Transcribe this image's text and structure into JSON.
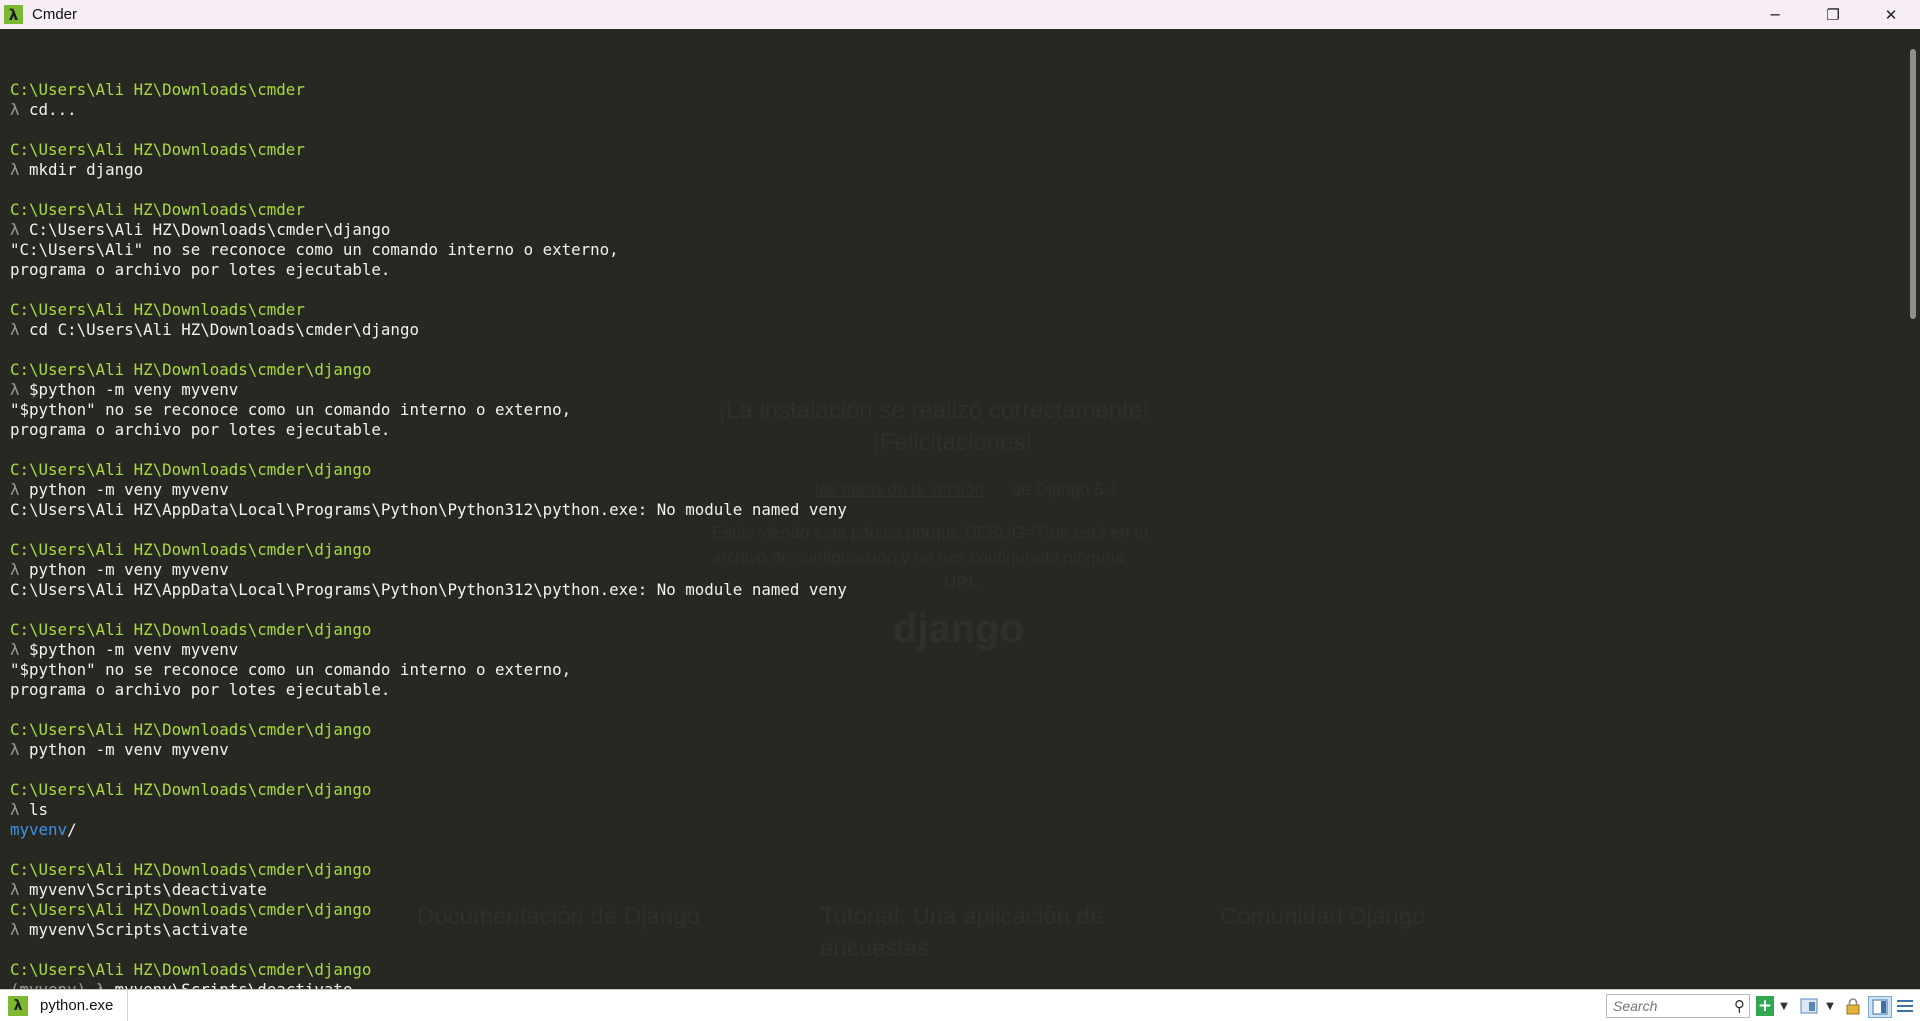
{
  "window": {
    "title": "Cmder",
    "app_icon_glyph": "λ",
    "minimize_glyph": "─",
    "restore_glyph": "❐",
    "close_glyph": "✕"
  },
  "background_ghost": {
    "heading1": "¡La instalación se realizó correctamente!",
    "heading2": "¡Felicitaciones!",
    "notes_link": "las notas de la versión",
    "notes_rest": "de Django 5.1",
    "debug_line1": "Estás viendo esta página porque DEBUG=True está en tu",
    "debug_line2": "archivo de configuración y no has configurado ninguna",
    "debug_line3": "URL.",
    "brand": "django",
    "footer_docs": "Documentación de Django",
    "footer_tutorial": "Tutorial: Una aplicación de",
    "footer_tutorial2": "encuestas",
    "footer_community": "Comunidad Django"
  },
  "terminal": {
    "lines": [
      {
        "type": "blank"
      },
      {
        "type": "path",
        "text": "C:\\Users\\Ali HZ\\Downloads\\cmder"
      },
      {
        "type": "cmd",
        "text": "cd..."
      },
      {
        "type": "blank"
      },
      {
        "type": "path",
        "text": "C:\\Users\\Ali HZ\\Downloads\\cmder"
      },
      {
        "type": "cmd",
        "text": "mkdir django"
      },
      {
        "type": "blank"
      },
      {
        "type": "path",
        "text": "C:\\Users\\Ali HZ\\Downloads\\cmder"
      },
      {
        "type": "cmd",
        "text": "C:\\Users\\Ali HZ\\Downloads\\cmder\\django"
      },
      {
        "type": "out",
        "text": "\"C:\\Users\\Ali\" no se reconoce como un comando interno o externo,"
      },
      {
        "type": "out",
        "text": "programa o archivo por lotes ejecutable."
      },
      {
        "type": "blank"
      },
      {
        "type": "path",
        "text": "C:\\Users\\Ali HZ\\Downloads\\cmder"
      },
      {
        "type": "cmd",
        "text": "cd C:\\Users\\Ali HZ\\Downloads\\cmder\\django"
      },
      {
        "type": "blank"
      },
      {
        "type": "path",
        "text": "C:\\Users\\Ali HZ\\Downloads\\cmder\\django"
      },
      {
        "type": "cmd",
        "text": "$python -m veny myvenv"
      },
      {
        "type": "out",
        "text": "\"$python\" no se reconoce como un comando interno o externo,"
      },
      {
        "type": "out",
        "text": "programa o archivo por lotes ejecutable."
      },
      {
        "type": "blank"
      },
      {
        "type": "path",
        "text": "C:\\Users\\Ali HZ\\Downloads\\cmder\\django"
      },
      {
        "type": "cmd",
        "text": "python -m veny myvenv"
      },
      {
        "type": "out",
        "text": "C:\\Users\\Ali HZ\\AppData\\Local\\Programs\\Python\\Python312\\python.exe: No module named veny"
      },
      {
        "type": "blank"
      },
      {
        "type": "path",
        "text": "C:\\Users\\Ali HZ\\Downloads\\cmder\\django"
      },
      {
        "type": "cmd",
        "text": "python -m veny myvenv"
      },
      {
        "type": "out",
        "text": "C:\\Users\\Ali HZ\\AppData\\Local\\Programs\\Python\\Python312\\python.exe: No module named veny"
      },
      {
        "type": "blank"
      },
      {
        "type": "path",
        "text": "C:\\Users\\Ali HZ\\Downloads\\cmder\\django"
      },
      {
        "type": "cmd",
        "text": "$python -m venv myvenv"
      },
      {
        "type": "out",
        "text": "\"$python\" no se reconoce como un comando interno o externo,"
      },
      {
        "type": "out",
        "text": "programa o archivo por lotes ejecutable."
      },
      {
        "type": "blank"
      },
      {
        "type": "path",
        "text": "C:\\Users\\Ali HZ\\Downloads\\cmder\\django"
      },
      {
        "type": "cmd",
        "text": "python -m venv myvenv"
      },
      {
        "type": "blank"
      },
      {
        "type": "path",
        "text": "C:\\Users\\Ali HZ\\Downloads\\cmder\\django"
      },
      {
        "type": "cmd",
        "text": "ls"
      },
      {
        "type": "dir",
        "text": "myvenv",
        "suffix": "/"
      },
      {
        "type": "blank"
      },
      {
        "type": "path",
        "text": "C:\\Users\\Ali HZ\\Downloads\\cmder\\django"
      },
      {
        "type": "cmd",
        "text": "myvenv\\Scripts\\deactivate"
      },
      {
        "type": "path",
        "text": "C:\\Users\\Ali HZ\\Downloads\\cmder\\django"
      },
      {
        "type": "cmd",
        "text": "myvenv\\Scripts\\activate"
      },
      {
        "type": "blank"
      },
      {
        "type": "path",
        "text": "C:\\Users\\Ali HZ\\Downloads\\cmder\\django"
      },
      {
        "type": "venvcmd",
        "prefix": "(myvenv)",
        "text": "myvenv\\Scripts\\deactivate"
      }
    ],
    "prompt_glyph": "λ"
  },
  "statusbar": {
    "tab_label": "python.exe",
    "tab_icon_glyph": "λ",
    "search_placeholder": "Search",
    "new_console_glyph": "+",
    "colors": {
      "path": "#a8dc3b",
      "dir": "#3b93e8",
      "accent": "#7db832",
      "background": "#272822"
    }
  }
}
